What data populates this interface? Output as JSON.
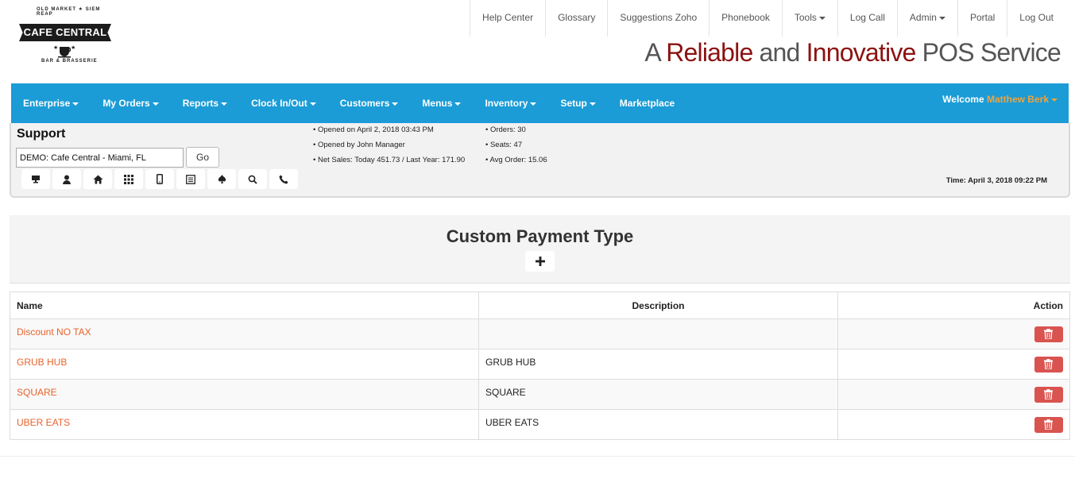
{
  "logo": {
    "brand": "CAFE CENTRAL",
    "top_text": "OLD MARKET ★ SIEM REAP",
    "bottom_text": "BAR & BRASSERIE"
  },
  "top_links": [
    {
      "label": "Help Center",
      "dropdown": false
    },
    {
      "label": "Glossary",
      "dropdown": false
    },
    {
      "label": "Suggestions Zoho",
      "dropdown": false
    },
    {
      "label": "Phonebook",
      "dropdown": false
    },
    {
      "label": "Tools",
      "dropdown": true
    },
    {
      "label": "Log Call",
      "dropdown": false
    },
    {
      "label": "Admin",
      "dropdown": true
    },
    {
      "label": "Portal",
      "dropdown": false
    },
    {
      "label": "Log Out",
      "dropdown": false
    }
  ],
  "tagline": {
    "p1": "A ",
    "p2": "Reliable",
    "p3": " and ",
    "p4": "Innovative",
    "p5": " POS Service"
  },
  "nav": {
    "items": [
      {
        "label": "Enterprise",
        "dropdown": true
      },
      {
        "label": "My Orders",
        "dropdown": true
      },
      {
        "label": "Reports",
        "dropdown": true
      },
      {
        "label": "Clock In/Out",
        "dropdown": true
      },
      {
        "label": "Customers",
        "dropdown": true
      },
      {
        "label": "Menus",
        "dropdown": true
      },
      {
        "label": "Inventory",
        "dropdown": true
      },
      {
        "label": "Setup",
        "dropdown": true
      },
      {
        "label": "Marketplace",
        "dropdown": false
      }
    ],
    "welcome_label": "Welcome",
    "user_name": "Matthew Berk"
  },
  "support": {
    "title": "Support",
    "store_value": "DEMO: Cafe Central - Miami, FL",
    "go_label": "Go",
    "icons": [
      "desktop-icon",
      "user-icon",
      "home-icon",
      "grid-icon",
      "mobile-icon",
      "list-icon",
      "spade-icon",
      "search-icon",
      "phone-icon"
    ],
    "stats_left": [
      "• Opened on April 2, 2018 03:43 PM",
      "• Opened by John Manager",
      "• Net Sales: Today 451.73 / Last Year: 171.90"
    ],
    "stats_right": [
      "• Orders: 30",
      "• Seats: 47",
      "• Avg Order: 15.06"
    ],
    "time": "Time: April 3, 2018 09:22 PM"
  },
  "main": {
    "title": "Custom Payment Type",
    "add_label": "+",
    "columns": {
      "name": "Name",
      "description": "Description",
      "action": "Action"
    },
    "rows": [
      {
        "name": "Discount NO TAX",
        "description": ""
      },
      {
        "name": "GRUB HUB",
        "description": "GRUB HUB"
      },
      {
        "name": "SQUARE",
        "description": "SQUARE"
      },
      {
        "name": "UBER EATS",
        "description": "UBER EATS"
      }
    ]
  },
  "colors": {
    "nav_bg": "#1b9cd6",
    "link_orange": "#e8622c",
    "user_orange": "#f0a33c",
    "delete_red": "#d9534f",
    "tagline_red": "#8b1212"
  }
}
